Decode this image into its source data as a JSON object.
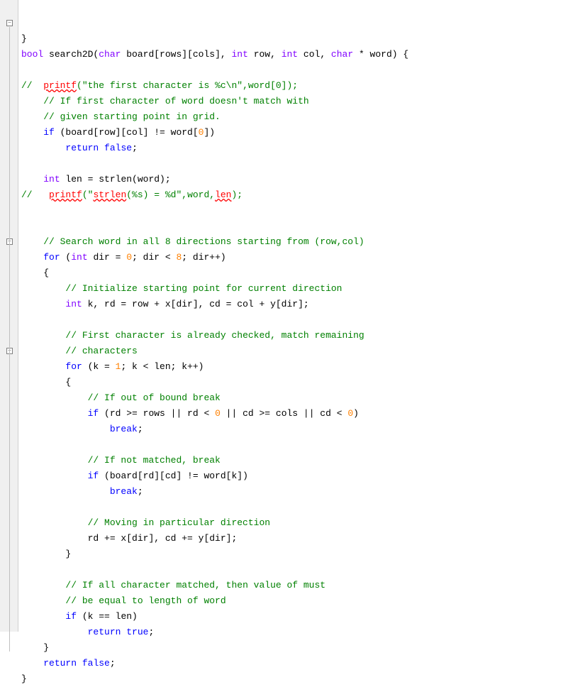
{
  "lines": [
    {
      "indent": 0,
      "segs": [
        {
          "t": "}",
          "c": "op"
        }
      ]
    },
    {
      "indent": 0,
      "segs": [
        {
          "t": "bool",
          "c": "type"
        },
        {
          "t": " search2D(",
          "c": "op"
        },
        {
          "t": "char",
          "c": "type"
        },
        {
          "t": " board[rows][cols], ",
          "c": "op"
        },
        {
          "t": "int",
          "c": "type"
        },
        {
          "t": " row, ",
          "c": "op"
        },
        {
          "t": "int",
          "c": "type"
        },
        {
          "t": " col, ",
          "c": "op"
        },
        {
          "t": "char",
          "c": "type"
        },
        {
          "t": " * word) {",
          "c": "op"
        }
      ]
    },
    {
      "indent": 0,
      "segs": []
    },
    {
      "indent": 0,
      "segs": [
        {
          "t": "//  ",
          "c": "cm"
        },
        {
          "t": "printf",
          "c": "sq"
        },
        {
          "t": "(\"the first character is %c\\n\",word[0]);",
          "c": "cm"
        }
      ]
    },
    {
      "indent": 1,
      "segs": [
        {
          "t": "// If first character of word doesn't match with",
          "c": "cm"
        }
      ]
    },
    {
      "indent": 1,
      "segs": [
        {
          "t": "// given starting point in grid.",
          "c": "cm"
        }
      ]
    },
    {
      "indent": 1,
      "segs": [
        {
          "t": "if",
          "c": "kw"
        },
        {
          "t": " (board[row][col] != word[",
          "c": "op"
        },
        {
          "t": "0",
          "c": "num"
        },
        {
          "t": "])",
          "c": "op"
        }
      ]
    },
    {
      "indent": 2,
      "segs": [
        {
          "t": "return",
          "c": "kw"
        },
        {
          "t": " ",
          "c": "op"
        },
        {
          "t": "false",
          "c": "kw"
        },
        {
          "t": ";",
          "c": "op"
        }
      ]
    },
    {
      "indent": 0,
      "segs": []
    },
    {
      "indent": 1,
      "segs": [
        {
          "t": "int",
          "c": "type"
        },
        {
          "t": " len = strlen(word);",
          "c": "op"
        }
      ]
    },
    {
      "indent": 0,
      "segs": [
        {
          "t": "//   ",
          "c": "cm"
        },
        {
          "t": "printf",
          "c": "sq"
        },
        {
          "t": "(\"",
          "c": "cm"
        },
        {
          "t": "strlen",
          "c": "sq"
        },
        {
          "t": "(%s) = %d\",word,",
          "c": "cm"
        },
        {
          "t": "len",
          "c": "sq"
        },
        {
          "t": ");",
          "c": "cm"
        }
      ]
    },
    {
      "indent": 0,
      "segs": []
    },
    {
      "indent": 0,
      "segs": []
    },
    {
      "indent": 1,
      "segs": [
        {
          "t": "// Search word in all 8 directions starting from (row,col)",
          "c": "cm"
        }
      ]
    },
    {
      "indent": 1,
      "segs": [
        {
          "t": "for",
          "c": "kw"
        },
        {
          "t": " (",
          "c": "op"
        },
        {
          "t": "int",
          "c": "type"
        },
        {
          "t": " dir = ",
          "c": "op"
        },
        {
          "t": "0",
          "c": "num"
        },
        {
          "t": "; dir < ",
          "c": "op"
        },
        {
          "t": "8",
          "c": "num"
        },
        {
          "t": "; dir++)",
          "c": "op"
        }
      ]
    },
    {
      "indent": 1,
      "segs": [
        {
          "t": "{",
          "c": "op"
        }
      ]
    },
    {
      "indent": 2,
      "segs": [
        {
          "t": "// Initialize starting point for current direction",
          "c": "cm"
        }
      ]
    },
    {
      "indent": 2,
      "segs": [
        {
          "t": "int",
          "c": "type"
        },
        {
          "t": " k, rd = row + x[dir], cd = col + y[dir];",
          "c": "op"
        }
      ]
    },
    {
      "indent": 0,
      "segs": []
    },
    {
      "indent": 2,
      "segs": [
        {
          "t": "// First character is already checked, match remaining",
          "c": "cm"
        }
      ]
    },
    {
      "indent": 2,
      "segs": [
        {
          "t": "// characters",
          "c": "cm"
        }
      ]
    },
    {
      "indent": 2,
      "segs": [
        {
          "t": "for",
          "c": "kw"
        },
        {
          "t": " (k = ",
          "c": "op"
        },
        {
          "t": "1",
          "c": "num"
        },
        {
          "t": "; k < len; k++)",
          "c": "op"
        }
      ]
    },
    {
      "indent": 2,
      "segs": [
        {
          "t": "{",
          "c": "op"
        }
      ]
    },
    {
      "indent": 3,
      "segs": [
        {
          "t": "// If out of bound break",
          "c": "cm"
        }
      ]
    },
    {
      "indent": 3,
      "segs": [
        {
          "t": "if",
          "c": "kw"
        },
        {
          "t": " (rd >= rows || rd < ",
          "c": "op"
        },
        {
          "t": "0",
          "c": "num"
        },
        {
          "t": " || cd >= cols || cd < ",
          "c": "op"
        },
        {
          "t": "0",
          "c": "num"
        },
        {
          "t": ")",
          "c": "op"
        }
      ]
    },
    {
      "indent": 4,
      "segs": [
        {
          "t": "break",
          "c": "kw"
        },
        {
          "t": ";",
          "c": "op"
        }
      ]
    },
    {
      "indent": 0,
      "segs": []
    },
    {
      "indent": 3,
      "segs": [
        {
          "t": "// If not matched, break",
          "c": "cm"
        }
      ]
    },
    {
      "indent": 3,
      "segs": [
        {
          "t": "if",
          "c": "kw"
        },
        {
          "t": " (board[rd][cd] != word[k])",
          "c": "op"
        }
      ]
    },
    {
      "indent": 4,
      "segs": [
        {
          "t": "break",
          "c": "kw"
        },
        {
          "t": ";",
          "c": "op"
        }
      ]
    },
    {
      "indent": 0,
      "segs": []
    },
    {
      "indent": 3,
      "segs": [
        {
          "t": "// Moving in particular direction",
          "c": "cm"
        }
      ]
    },
    {
      "indent": 3,
      "segs": [
        {
          "t": "rd += x[dir], cd += y[dir];",
          "c": "op"
        }
      ]
    },
    {
      "indent": 2,
      "segs": [
        {
          "t": "}",
          "c": "op"
        }
      ]
    },
    {
      "indent": 0,
      "segs": []
    },
    {
      "indent": 2,
      "segs": [
        {
          "t": "// If all character matched, then value of must",
          "c": "cm"
        }
      ]
    },
    {
      "indent": 2,
      "segs": [
        {
          "t": "// be equal to length of word",
          "c": "cm"
        }
      ]
    },
    {
      "indent": 2,
      "segs": [
        {
          "t": "if",
          "c": "kw"
        },
        {
          "t": " (k == len)",
          "c": "op"
        }
      ]
    },
    {
      "indent": 3,
      "segs": [
        {
          "t": "return",
          "c": "kw"
        },
        {
          "t": " ",
          "c": "op"
        },
        {
          "t": "true",
          "c": "kw"
        },
        {
          "t": ";",
          "c": "op"
        }
      ]
    },
    {
      "indent": 1,
      "segs": [
        {
          "t": "}",
          "c": "op"
        }
      ]
    },
    {
      "indent": 1,
      "segs": [
        {
          "t": "return",
          "c": "kw"
        },
        {
          "t": " ",
          "c": "op"
        },
        {
          "t": "false",
          "c": "kw"
        },
        {
          "t": ";",
          "c": "op"
        }
      ]
    },
    {
      "indent": 0,
      "segs": [
        {
          "t": "}",
          "c": "op"
        }
      ]
    }
  ],
  "fold_icons": [
    {
      "line": 1
    },
    {
      "line": 15
    },
    {
      "line": 22
    }
  ]
}
